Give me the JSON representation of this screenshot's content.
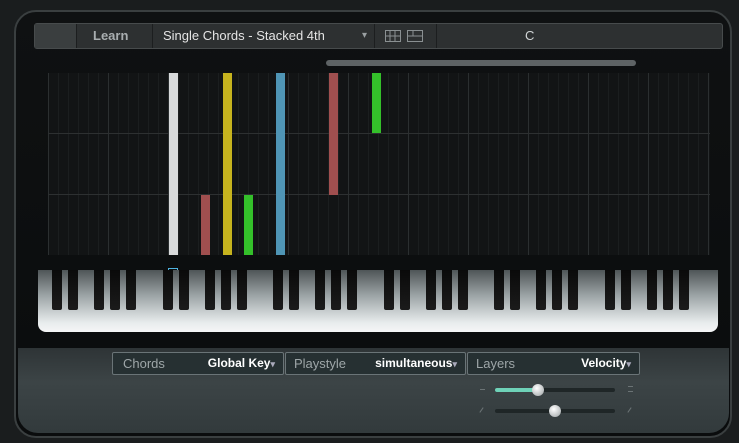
{
  "toolbar": {
    "learn_label": "Learn",
    "mode_label": "Single Chords - Stacked 4th",
    "mode_arrow": "▾",
    "key_label": "C"
  },
  "note_bars": [
    {
      "color": "#d8dadb",
      "level_top": 1.0,
      "level_bottom": 0.0
    },
    {
      "color": "#c6b31e",
      "level_top": 1.0,
      "level_bottom": 0.0
    },
    {
      "color": "#4f95b5",
      "level_top": 1.0,
      "level_bottom": 0.0
    },
    {
      "color": "#a04f4f",
      "level_top": 1.0,
      "level_bottom": 0.33
    },
    {
      "color": "#34c02a",
      "level_top": 1.0,
      "level_bottom": 0.67
    },
    {
      "color": "#a04f4f",
      "level_top": 0.33,
      "level_bottom": 0.0
    },
    {
      "color": "#34c02a",
      "level_top": 0.33,
      "level_bottom": 0.0
    }
  ],
  "controls": {
    "chords_label": "Chords",
    "chords_value": "Global Key",
    "playstyle_label": "Playstyle",
    "playstyle_value": "simultaneous",
    "layers_label": "Layers",
    "layers_value": "Velocity",
    "arrow": "▾"
  },
  "sliders": {
    "upper_level": 0.36,
    "lower_level": 0.5
  },
  "colors": {
    "accent_green": "#34c02a",
    "accent_yellow": "#c6b31e",
    "accent_blue": "#4f95b5",
    "accent_red": "#a04f4f"
  }
}
